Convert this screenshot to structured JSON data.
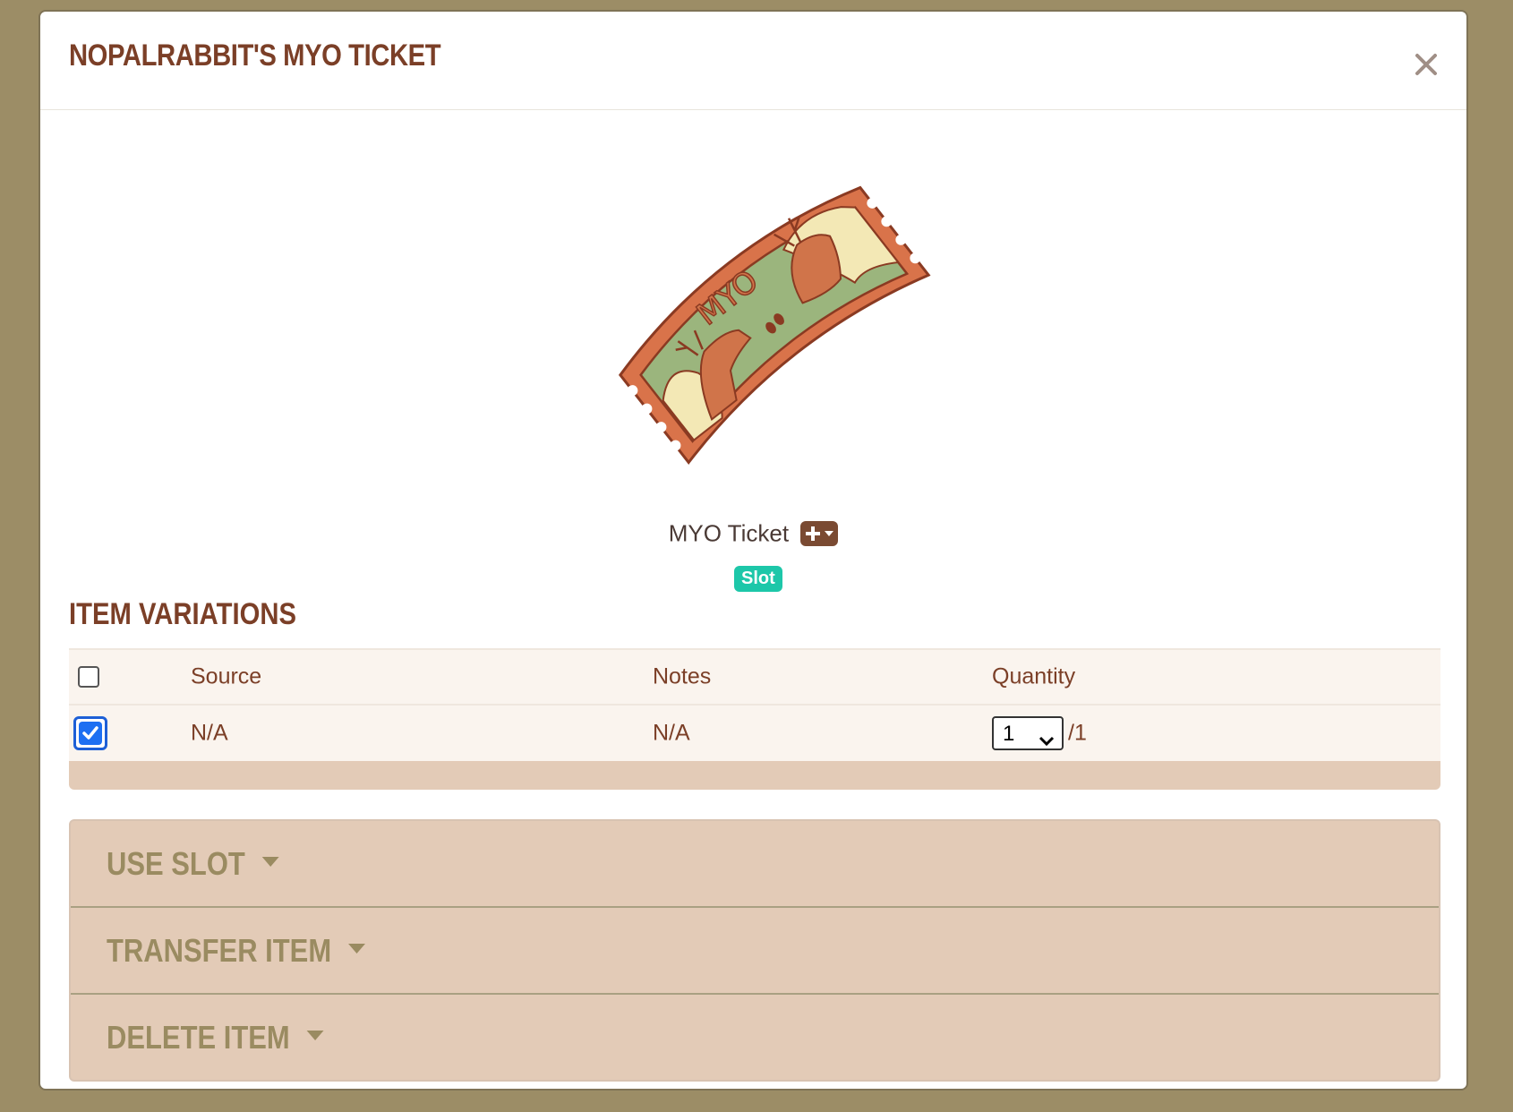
{
  "modal": {
    "title": "NOPALRABBIT'S MYO TICKET"
  },
  "item": {
    "name": "MYO Ticket",
    "tag": "Slot",
    "image_text": "MYO"
  },
  "variations": {
    "title": "ITEM VARIATIONS",
    "columns": [
      "Source",
      "Notes",
      "Quantity"
    ],
    "rows": [
      {
        "checked": true,
        "source": "N/A",
        "notes": "N/A",
        "quantity_selected": "1",
        "quantity_max": "/1"
      }
    ],
    "header_checked": false
  },
  "actions": [
    {
      "label": "USE SLOT"
    },
    {
      "label": "TRANSFER ITEM"
    },
    {
      "label": "DELETE ITEM"
    }
  ],
  "colors": {
    "background": "#9c8d66",
    "title_text": "#7b3f27",
    "badge": "#1dc7a9",
    "accordion_bg": "#e3cbb7",
    "accordion_text": "#9a8b61",
    "checkbox_checked": "#1d6ff2"
  }
}
